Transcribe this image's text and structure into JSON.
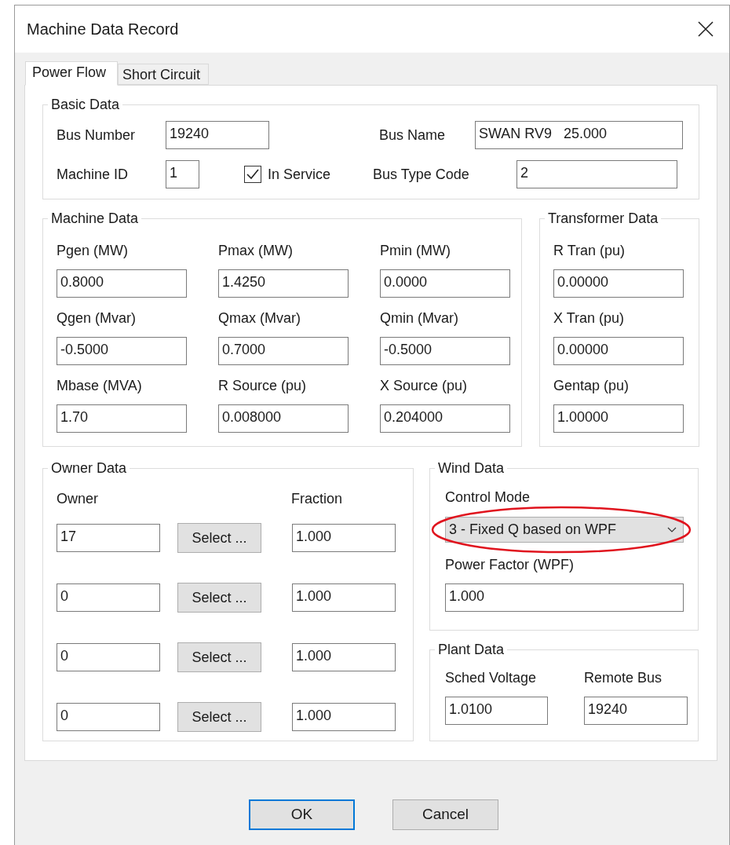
{
  "window": {
    "title": "Machine Data Record"
  },
  "tabs": [
    {
      "label": "Power Flow",
      "selected": true
    },
    {
      "label": "Short Circuit",
      "selected": false
    }
  ],
  "basic_data": {
    "title": "Basic Data",
    "bus_number": {
      "label": "Bus Number",
      "value": "19240"
    },
    "bus_name": {
      "label": "Bus Name",
      "value": "SWAN RV9   25.000"
    },
    "machine_id": {
      "label": "Machine ID",
      "value": "1"
    },
    "in_service": {
      "label": "In Service",
      "checked": true
    },
    "bus_type_code": {
      "label": "Bus Type Code",
      "value": "2"
    }
  },
  "machine_data": {
    "title": "Machine Data",
    "fields": [
      {
        "label": "Pgen (MW)",
        "value": "0.8000"
      },
      {
        "label": "Pmax (MW)",
        "value": "1.4250"
      },
      {
        "label": "Pmin (MW)",
        "value": "0.0000"
      },
      {
        "label": "Qgen (Mvar)",
        "value": "-0.5000"
      },
      {
        "label": "Qmax (Mvar)",
        "value": "0.7000"
      },
      {
        "label": "Qmin (Mvar)",
        "value": "-0.5000"
      },
      {
        "label": "Mbase (MVA)",
        "value": "1.70"
      },
      {
        "label": "R Source (pu)",
        "value": "0.008000"
      },
      {
        "label": "X Source (pu)",
        "value": "0.204000"
      }
    ]
  },
  "transformer_data": {
    "title": "Transformer Data",
    "fields": [
      {
        "label": "R Tran (pu)",
        "value": "0.00000"
      },
      {
        "label": "X Tran (pu)",
        "value": "0.00000"
      },
      {
        "label": "Gentap (pu)",
        "value": "1.00000"
      }
    ]
  },
  "owner_data": {
    "title": "Owner Data",
    "columns": [
      "Owner",
      "Fraction"
    ],
    "rows": [
      {
        "owner": "17",
        "button": "Select ...",
        "fraction": "1.000"
      },
      {
        "owner": "0",
        "button": "Select ...",
        "fraction": "1.000"
      },
      {
        "owner": "0",
        "button": "Select ...",
        "fraction": "1.000"
      },
      {
        "owner": "0",
        "button": "Select ...",
        "fraction": "1.000"
      }
    ]
  },
  "wind_data": {
    "title": "Wind Data",
    "control_mode": {
      "label": "Control Mode",
      "value": "3 - Fixed Q based on WPF",
      "highlighted": true
    },
    "power_factor": {
      "label": "Power Factor (WPF)",
      "value": "1.000"
    }
  },
  "plant_data": {
    "title": "Plant Data",
    "fields": [
      {
        "label": "Sched Voltage",
        "value": "1.0100"
      },
      {
        "label": "Remote Bus",
        "value": "19240"
      }
    ]
  },
  "buttons": [
    {
      "label": "OK",
      "default": true
    },
    {
      "label": "Cancel",
      "default": false
    }
  ]
}
